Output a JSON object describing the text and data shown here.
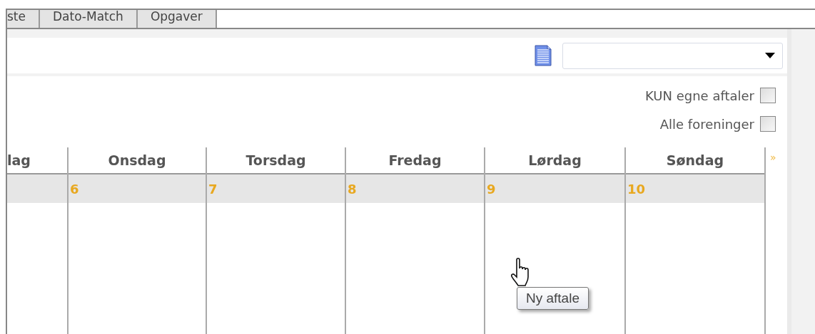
{
  "tabs": [
    {
      "label": "ste",
      "selected": false
    },
    {
      "label": "Dato-Match",
      "selected": false
    },
    {
      "label": "Opgaver",
      "selected": false
    }
  ],
  "filters": [
    {
      "label": "KUN egne aftaler",
      "checked": false
    },
    {
      "label": "Alle foreninger",
      "checked": false
    }
  ],
  "calendar": {
    "days": [
      {
        "name": "lag"
      },
      {
        "name": "Onsdag",
        "date": "6"
      },
      {
        "name": "Torsdag",
        "date": "7"
      },
      {
        "name": "Fredag",
        "date": "8"
      },
      {
        "name": "Lørdag",
        "date": "9"
      },
      {
        "name": "Søndag",
        "date": "10"
      }
    ],
    "next": "»"
  },
  "tooltip": {
    "text": "Ny aftale"
  }
}
